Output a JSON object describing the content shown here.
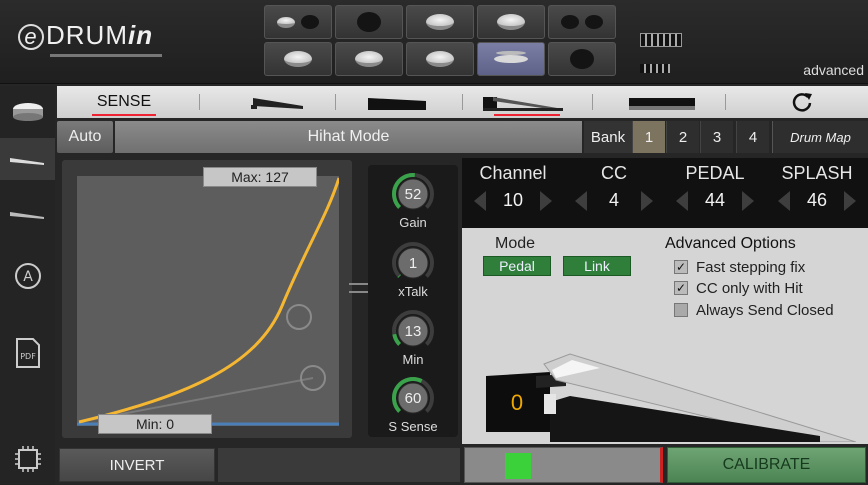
{
  "logo": {
    "prefix": "e",
    "main": "DRUM",
    "suffix": "in"
  },
  "header": {
    "mode_label": "advanced"
  },
  "tabs": {
    "sense_label": "SENSE",
    "reset_icon": "refresh-icon"
  },
  "mode_row": {
    "auto_label": "Auto",
    "title": "Hihat Mode",
    "bank_label": "Bank",
    "banks": [
      "1",
      "2",
      "3",
      "4"
    ],
    "selected_bank": "1",
    "drum_map_label": "Drum Map"
  },
  "curve": {
    "max_label": "Max: 127",
    "min_label": "Min: 0",
    "max_value": 127,
    "min_value": 0
  },
  "knobs": [
    {
      "label": "Gain",
      "value": "52",
      "level": 0.52
    },
    {
      "label": "xTalk",
      "value": "1",
      "level": 0.01
    },
    {
      "label": "Min",
      "value": "13",
      "level": 0.13
    },
    {
      "label": "S Sense",
      "value": "60",
      "level": 0.6
    }
  ],
  "midi": [
    {
      "title": "Channel",
      "value": "10"
    },
    {
      "title": "CC",
      "value": "4"
    },
    {
      "title": "PEDAL",
      "value": "44"
    },
    {
      "title": "SPLASH",
      "value": "46"
    }
  ],
  "mode": {
    "label": "Mode",
    "pedal_label": "Pedal",
    "link_label": "Link"
  },
  "advanced_options": {
    "title": "Advanced Options",
    "fast_stepping": "Fast stepping fix",
    "cc_only_hit": "CC only with Hit",
    "always_closed": "Always Send Closed"
  },
  "pedal": {
    "value": "0"
  },
  "bottom": {
    "invert_label": "INVERT",
    "calibrate_label": "CALIBRATE",
    "meter_level": 0.2
  },
  "colors": {
    "curve": "#f5b731",
    "accent_green": "#2f7f3a",
    "tab_underline": "#ee2233",
    "pedal_value": "#f0a800"
  }
}
